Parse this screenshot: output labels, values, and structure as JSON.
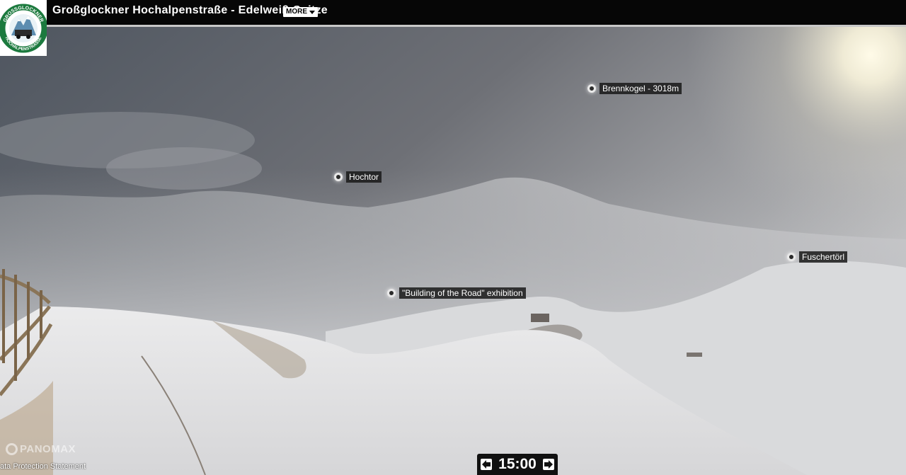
{
  "header": {
    "title": "Großglockner Hochalpenstraße - Edelweiß-Spitze",
    "more_label": "MORE",
    "logo_text_top": "GROSSGLOCKNER",
    "logo_text_bottom": "HOCHALPENSTRASSE"
  },
  "hotspots": [
    {
      "label": "Brennkogel - 3018m"
    },
    {
      "label": "Hochtor"
    },
    {
      "label": "Fuschertörl"
    },
    {
      "label": "\"Building of the Road\" exhibition"
    }
  ],
  "footer": {
    "brand": "PANOMAX",
    "privacy": "ata Protection Statement",
    "time": "15:00"
  },
  "colors": {
    "topbar": "#060606",
    "sky": "#6a6d73",
    "snow": "#e4e4e6",
    "label_bg": "#191919"
  }
}
